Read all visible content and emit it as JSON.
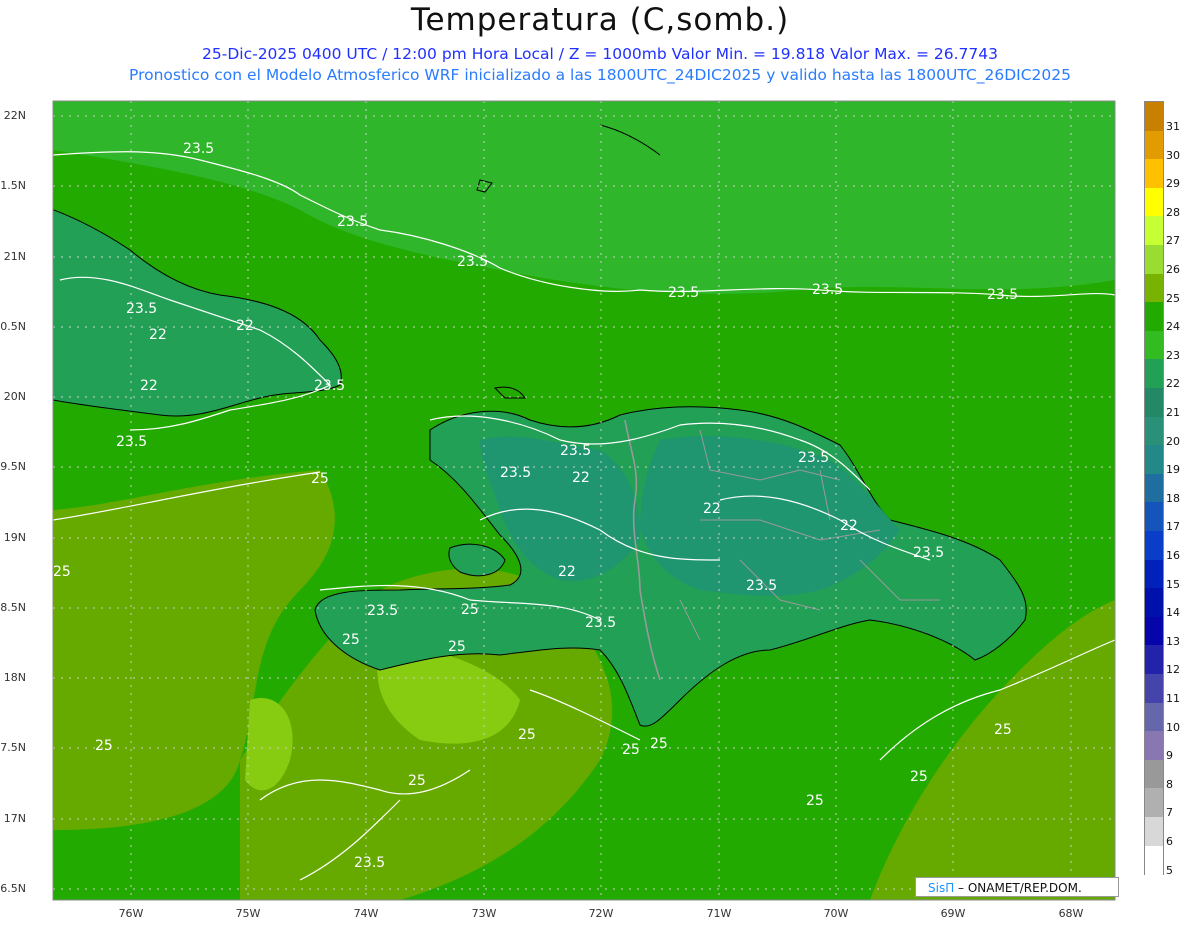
{
  "title": "Temperatura (C,somb.)",
  "subtitle_line1": "25-Dic-2025 0400 UTC / 12:00 pm Hora Local / Z = 1000mb   Valor Min. = 19.818  Valor Max. = 26.7743",
  "subtitle_line2": "Pronostico con el Modelo Atmosferico WRF inicializado a las 1800UTC_24DIC2025 y valido hasta las  1800UTC_26DIC2025",
  "credit": {
    "brand": "SisΠ",
    "text": " – ONAMET/REP.DOM."
  },
  "lat_labels": [
    "22N",
    "21.5N",
    "21N",
    "20.5N",
    "20N",
    "19.5N",
    "19N",
    "18.5N",
    "18N",
    "17.5N",
    "17N",
    "16.5N"
  ],
  "lon_labels": [
    "76W",
    "75W",
    "74W",
    "73W",
    "72W",
    "71W",
    "70W",
    "69W",
    "68W"
  ],
  "contour_labels": [
    "23.5",
    "23.5",
    "23.5",
    "23.5",
    "23.5",
    "23.5",
    "23.5",
    "22",
    "22",
    "22",
    "23.5",
    "23.5",
    "25",
    "25",
    "25",
    "25",
    "25",
    "25",
    "23.5",
    "22",
    "22",
    "22",
    "22",
    "23.5",
    "23.5",
    "23.5",
    "23.5",
    "23.5",
    "23.5",
    "25",
    "25",
    "25",
    "25",
    "25",
    "25",
    "25",
    "23.5"
  ],
  "colorbar": {
    "levels": [
      "31",
      "30",
      "29",
      "28",
      "27",
      "26",
      "25",
      "24",
      "23",
      "22",
      "21",
      "20",
      "19",
      "18",
      "17",
      "16",
      "15",
      "14",
      "13",
      "12",
      "11",
      "10",
      "9",
      "8",
      "7",
      "6",
      "5"
    ],
    "colors": [
      "#c78000",
      "#e29b00",
      "#ffc000",
      "#ffff00",
      "#c6ff33",
      "#99dd33",
      "#77b300",
      "#22aa00",
      "#33bb22",
      "#22a055",
      "#228866",
      "#2a9077",
      "#228888",
      "#1e6fa0",
      "#1555bb",
      "#0a3ec8",
      "#0022bb",
      "#0010aa",
      "#0505aa",
      "#2222aa",
      "#4444aa",
      "#6666aa",
      "#8877b0",
      "#999999",
      "#b0b0b0",
      "#d8d8d8",
      "#ffffff"
    ]
  },
  "palette": {
    "land_high": "#22a055",
    "sea_24": "#22aa00",
    "sea_23": "#2eb81e",
    "sea_25": "#66aa00",
    "sea_26": "#88cc11",
    "grid": "#d0d0d0",
    "coast": "#000000",
    "border": "#999999",
    "contour": "#ffffff"
  }
}
